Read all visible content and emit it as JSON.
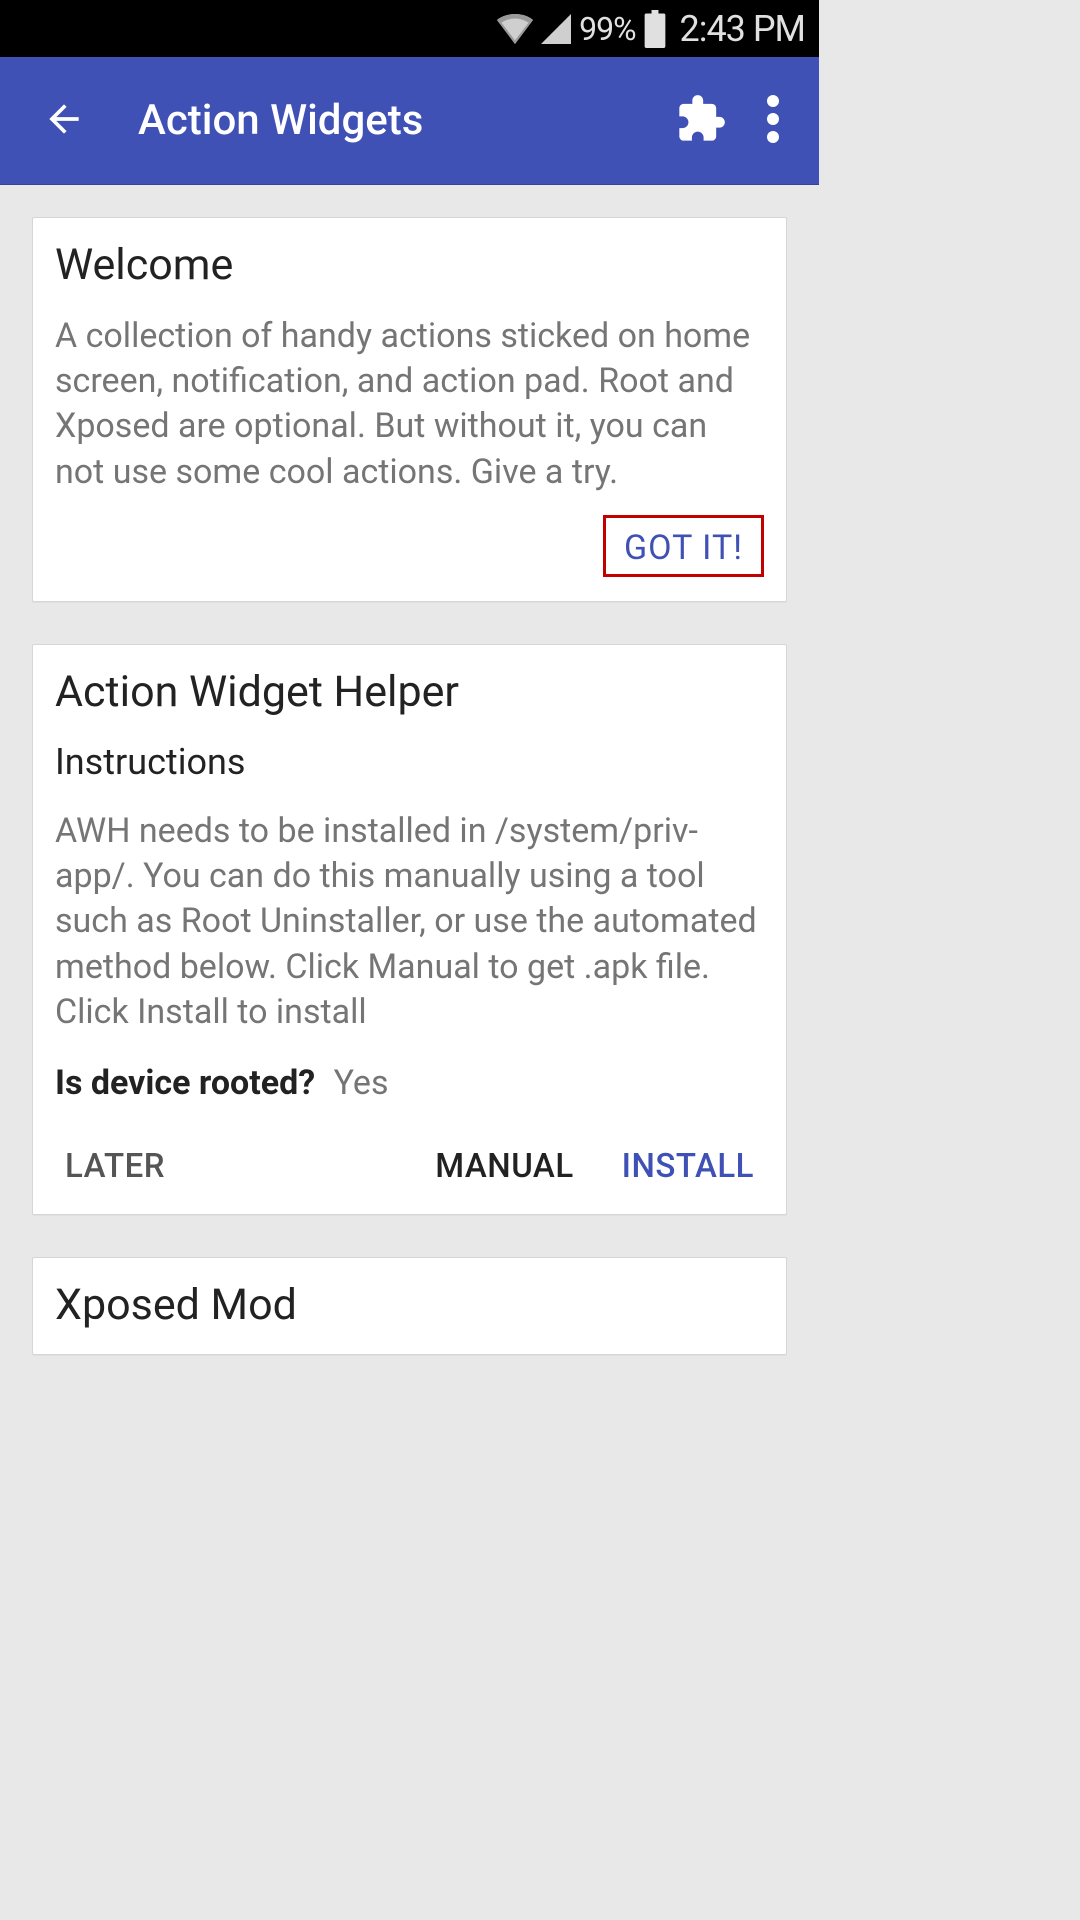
{
  "status": {
    "battery_pct": "99%",
    "time": "2:43 PM"
  },
  "appbar": {
    "title": "Action Widgets"
  },
  "cards": {
    "welcome": {
      "title": "Welcome",
      "body": "A collection of handy actions sticked on home screen, notification, and action pad. Root and Xposed are optional. But without it, you can not use some cool actions. Give a try.",
      "got_it": "GOT IT!"
    },
    "helper": {
      "title": "Action Widget Helper",
      "subtitle": "Instructions",
      "body": "AWH needs to be installed in /system/priv-app/. You can do this manually using a tool such as Root Uninstaller, or use the automated method below. Click Manual to get .apk file. Click Install to install",
      "rooted_label": "Is device rooted?",
      "rooted_value": "Yes",
      "later": "LATER",
      "manual": "MANUAL",
      "install": "INSTALL"
    },
    "xposed": {
      "title": "Xposed Mod"
    }
  }
}
